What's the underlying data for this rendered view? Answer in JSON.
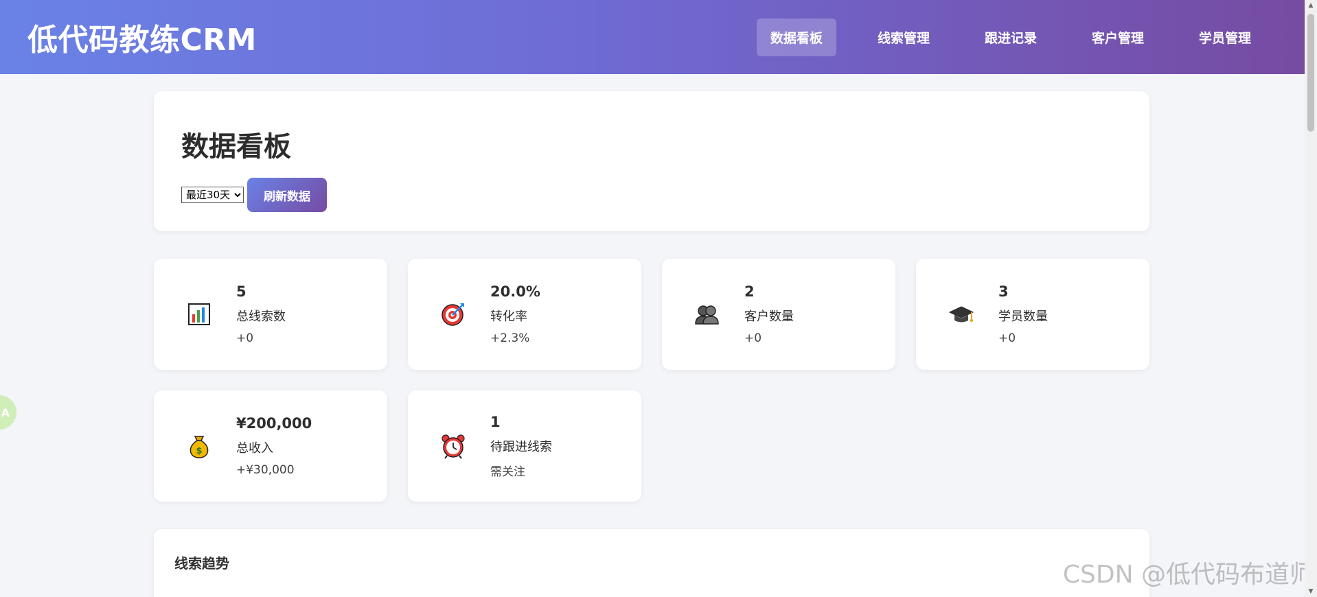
{
  "app": {
    "brand": "低代码教练CRM"
  },
  "nav": {
    "items": [
      {
        "label": "数据看板",
        "active": true
      },
      {
        "label": "线索管理"
      },
      {
        "label": "跟进记录"
      },
      {
        "label": "客户管理"
      },
      {
        "label": "学员管理"
      }
    ]
  },
  "dashboard": {
    "title": "数据看板",
    "range_selected": "最近30天",
    "refresh_label": "刷新数据"
  },
  "stats": [
    {
      "icon": "bar-chart-icon",
      "value": "5",
      "label": "总线索数",
      "change": "+0"
    },
    {
      "icon": "target-icon",
      "value": "20.0%",
      "label": "转化率",
      "change": "+2.3%"
    },
    {
      "icon": "users-icon",
      "value": "2",
      "label": "客户数量",
      "change": "+0"
    },
    {
      "icon": "graduation-cap-icon",
      "value": "3",
      "label": "学员数量",
      "change": "+0"
    },
    {
      "icon": "money-bag-icon",
      "value": "¥200,000",
      "label": "总收入",
      "change": "+¥30,000"
    },
    {
      "icon": "alarm-clock-icon",
      "value": "1",
      "label": "待跟进线索",
      "change": "需关注"
    }
  ],
  "chart_section": {
    "title": "线索趋势"
  },
  "float_widget": {
    "label": "A"
  },
  "watermark": "CSDN @低代码布道师",
  "colors": {
    "header_start": "#6a82e6",
    "header_end": "#764ba2",
    "background": "#f4f5f9"
  }
}
